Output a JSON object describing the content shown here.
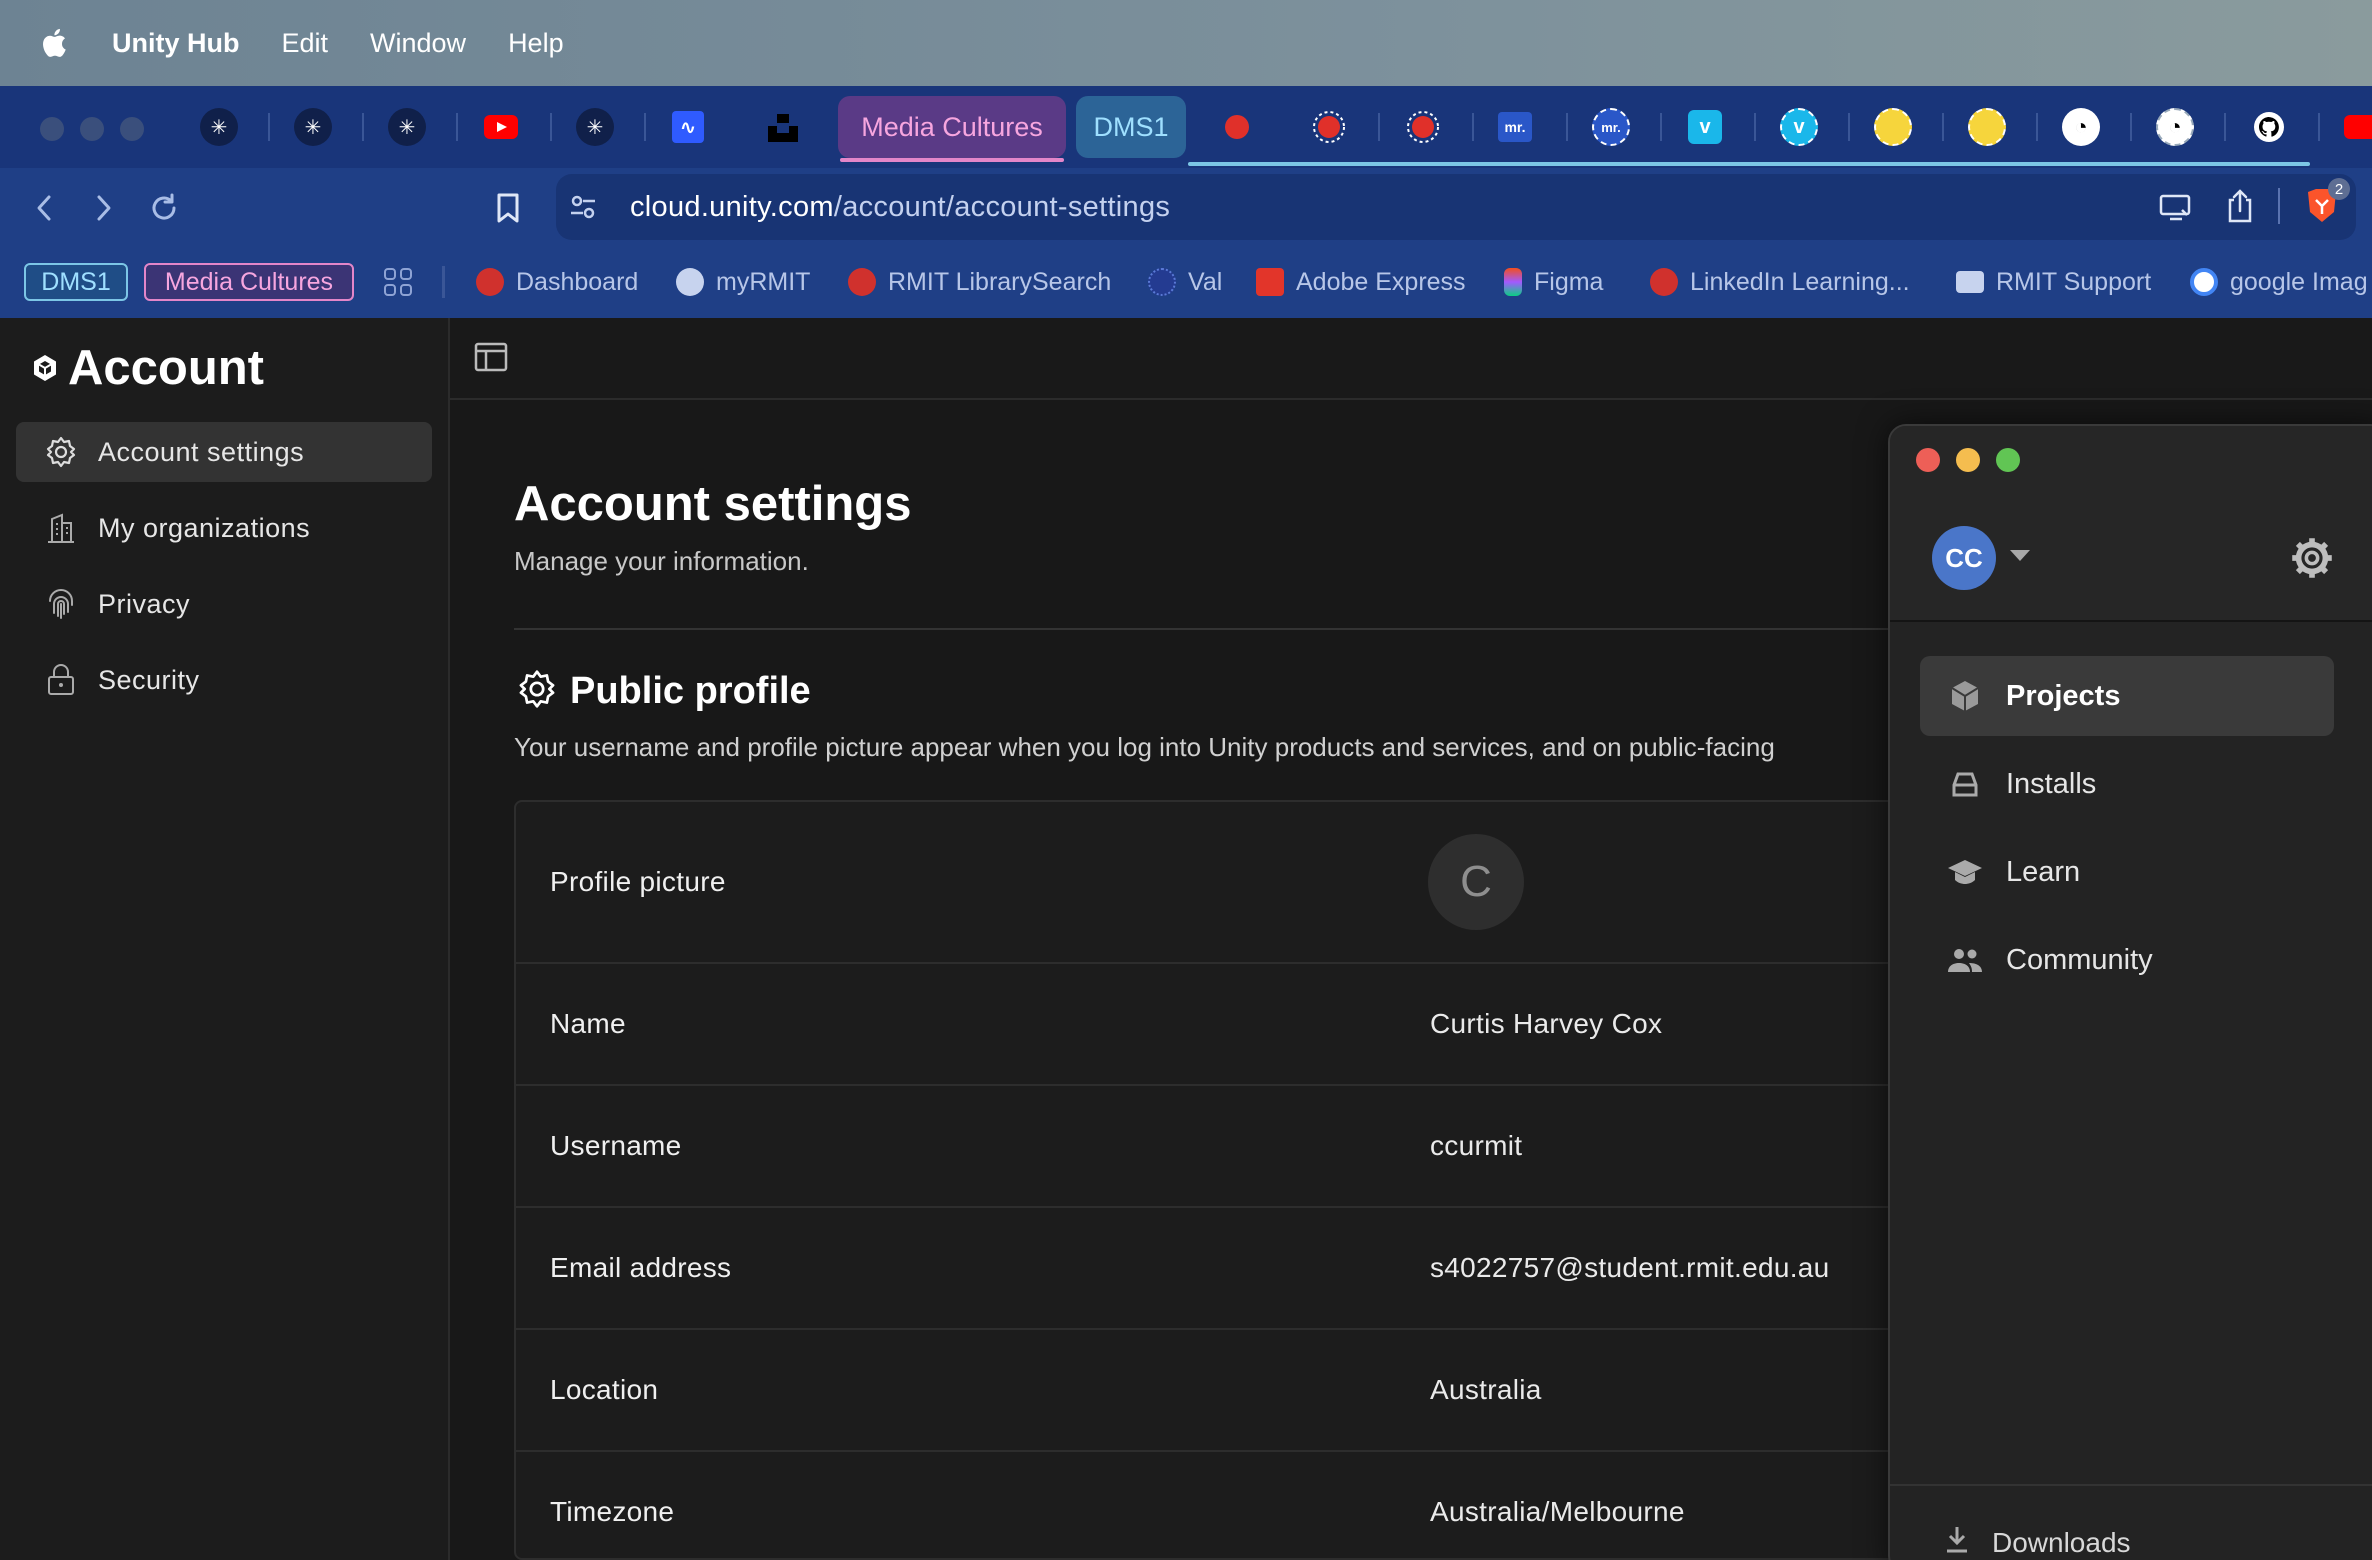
{
  "menubar": {
    "app_name": "Unity Hub",
    "items": [
      "Edit",
      "Window",
      "Help"
    ]
  },
  "browser": {
    "tab_groups": [
      {
        "label": "Media Cultures",
        "color": "#e386c9"
      },
      {
        "label": "DMS1",
        "color": "#7cc6e6"
      }
    ],
    "url_host": "cloud.unity.com",
    "url_path": "/account/account-settings",
    "shield_badge": "2",
    "bookmark_groups": [
      "DMS1",
      "Media Cultures"
    ],
    "bookmarks": [
      "Dashboard",
      "myRMIT",
      "RMIT LibrarySearch",
      "Val",
      "Adobe Express",
      "Figma",
      "LinkedIn Learning...",
      "RMIT Support",
      "google Imag"
    ]
  },
  "sidebar": {
    "title": "Account",
    "items": [
      {
        "label": "Account settings",
        "icon": "gear-icon",
        "active": true
      },
      {
        "label": "My organizations",
        "icon": "building-icon",
        "active": false
      },
      {
        "label": "Privacy",
        "icon": "fingerprint-icon",
        "active": false
      },
      {
        "label": "Security",
        "icon": "lock-icon",
        "active": false
      }
    ]
  },
  "page": {
    "title": "Account settings",
    "subtitle": "Manage your information.",
    "section_title": "Public profile",
    "section_desc": "Your username and profile picture appear when you log into Unity products and services, and on public-facing"
  },
  "profile": {
    "avatar_letter": "C",
    "rows": [
      {
        "label": "Profile picture",
        "value": ""
      },
      {
        "label": "Name",
        "value": "Curtis Harvey Cox"
      },
      {
        "label": "Username",
        "value": "ccurmit"
      },
      {
        "label": "Email address",
        "value": "s4022757@student.rmit.edu.au"
      },
      {
        "label": "Location",
        "value": "Australia"
      },
      {
        "label": "Timezone",
        "value": "Australia/Melbourne"
      }
    ]
  },
  "hub": {
    "avatar_initials": "CC",
    "items": [
      {
        "label": "Projects",
        "icon": "cube-icon",
        "active": true
      },
      {
        "label": "Installs",
        "icon": "drive-icon",
        "active": false
      },
      {
        "label": "Learn",
        "icon": "graduation-cap-icon",
        "active": false
      },
      {
        "label": "Community",
        "icon": "people-icon",
        "active": false
      }
    ],
    "downloads": "Downloads"
  },
  "colors": {
    "browser_bg": "#1f3f86",
    "sidebar_active": "#333333",
    "hub_active": "#3a3a3a",
    "avatar_blue": "#4a76c9"
  }
}
